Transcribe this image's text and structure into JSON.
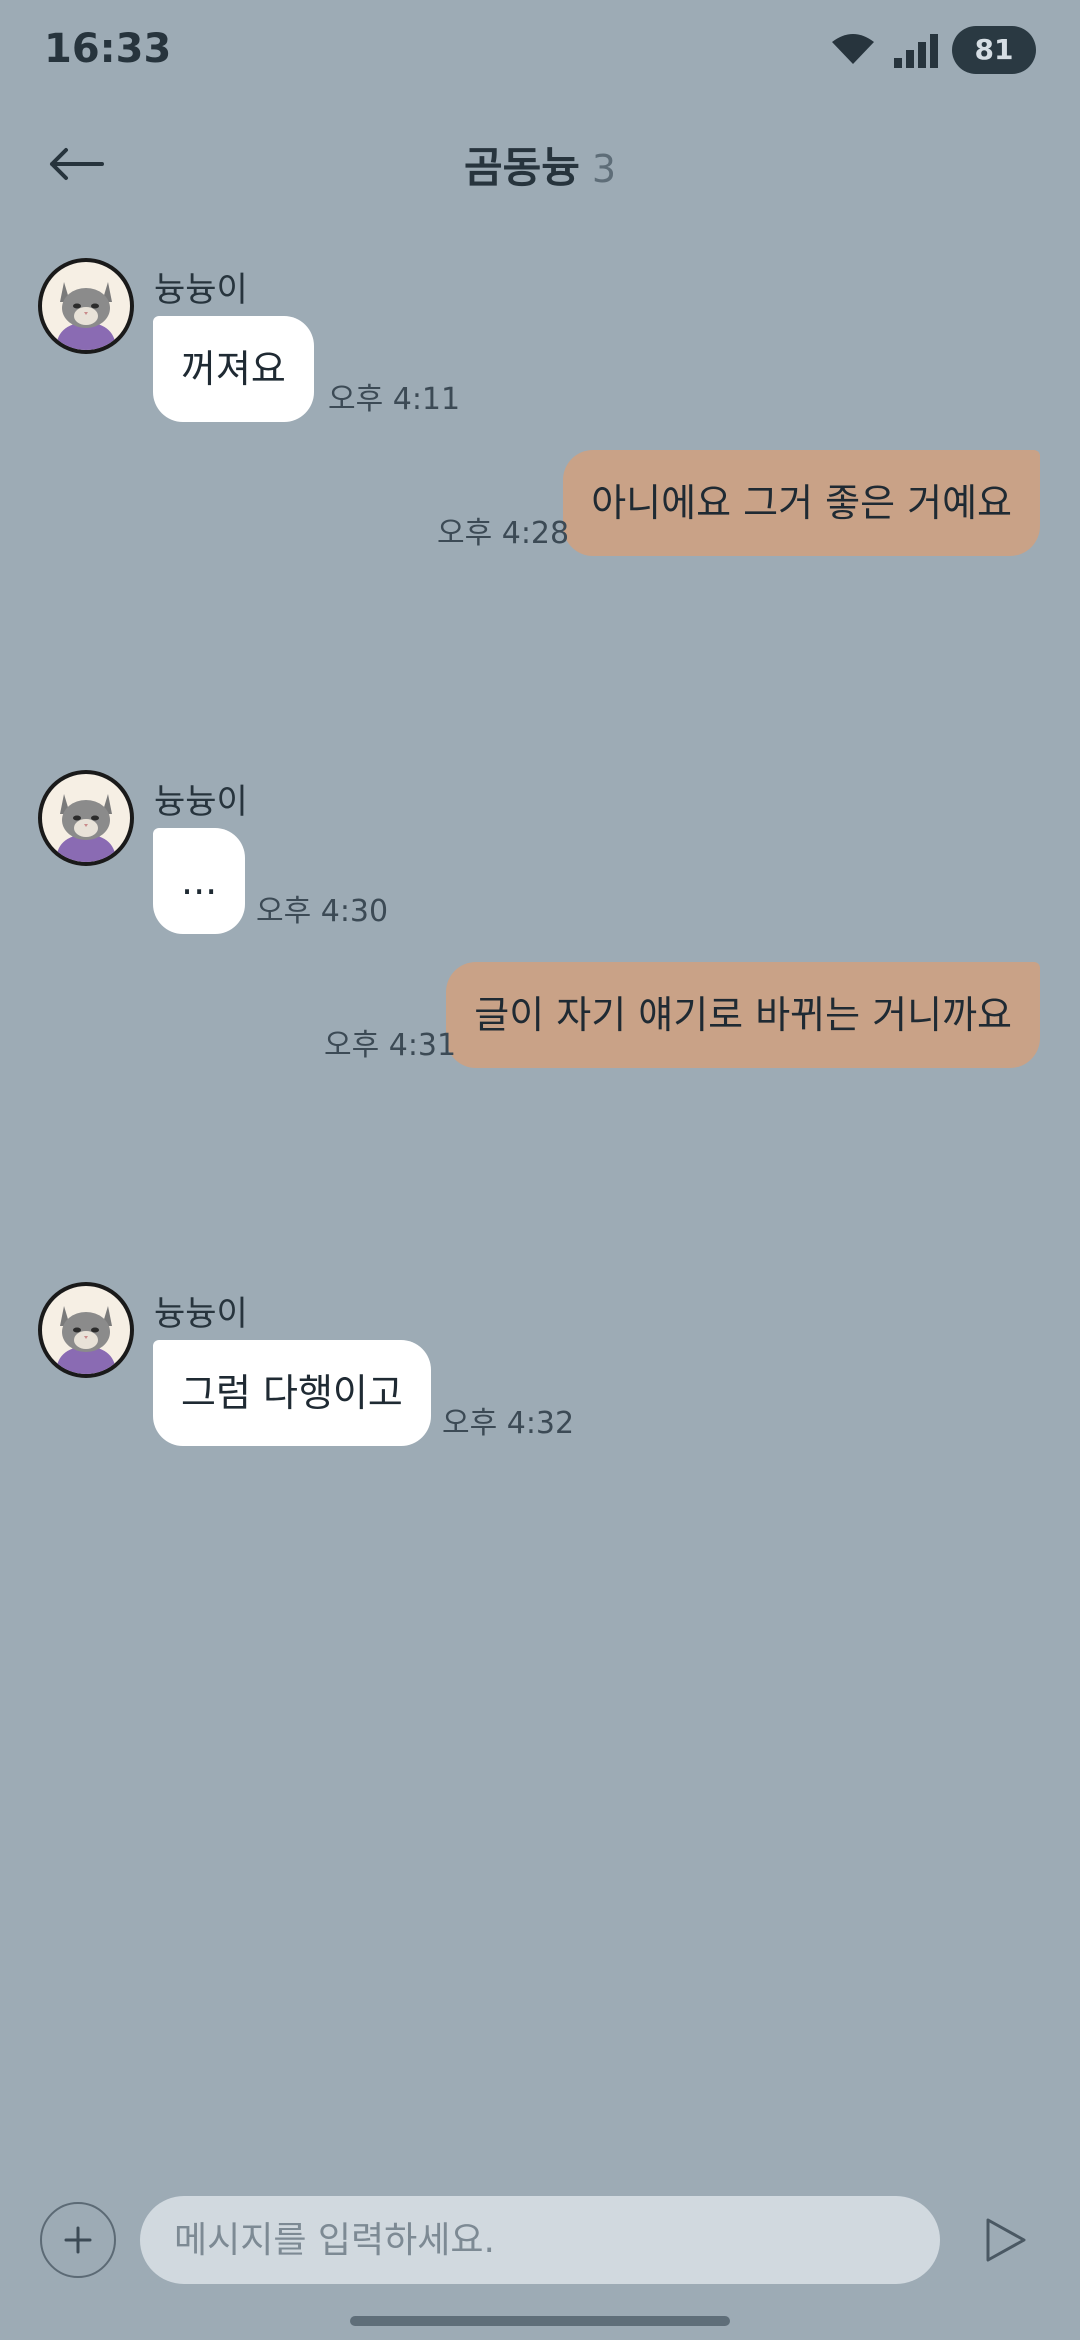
{
  "status_bar": {
    "time": "16:33",
    "battery": "81"
  },
  "header": {
    "title": "곰동늉",
    "member_count": "3"
  },
  "messages": [
    {
      "direction": "in",
      "sender": "늉늉이",
      "text": "꺼져요",
      "time": "오후 4:11"
    },
    {
      "direction": "out",
      "text": "아니에요 그거 좋은 거예요",
      "time": "오후 4:28"
    },
    {
      "direction": "in",
      "sender": "늉늉이",
      "text": "...",
      "time": "오후 4:30"
    },
    {
      "direction": "out",
      "text": "글이 자기 얘기로 바뀌는 거니까요",
      "time": "오후 4:31"
    },
    {
      "direction": "in",
      "sender": "늉늉이",
      "text": "그럼 다행이고",
      "time": "오후 4:32"
    }
  ],
  "input": {
    "placeholder": "메시지를 입력하세요."
  },
  "colors": {
    "background": "#9dabb5",
    "incoming_bubble": "#ffffff",
    "outgoing_bubble": "#c9a287",
    "battery_badge": "#2a3942"
  },
  "icons": [
    "wifi-icon",
    "signal-icon",
    "back-arrow-icon",
    "plus-icon",
    "send-icon",
    "cat-avatar"
  ]
}
